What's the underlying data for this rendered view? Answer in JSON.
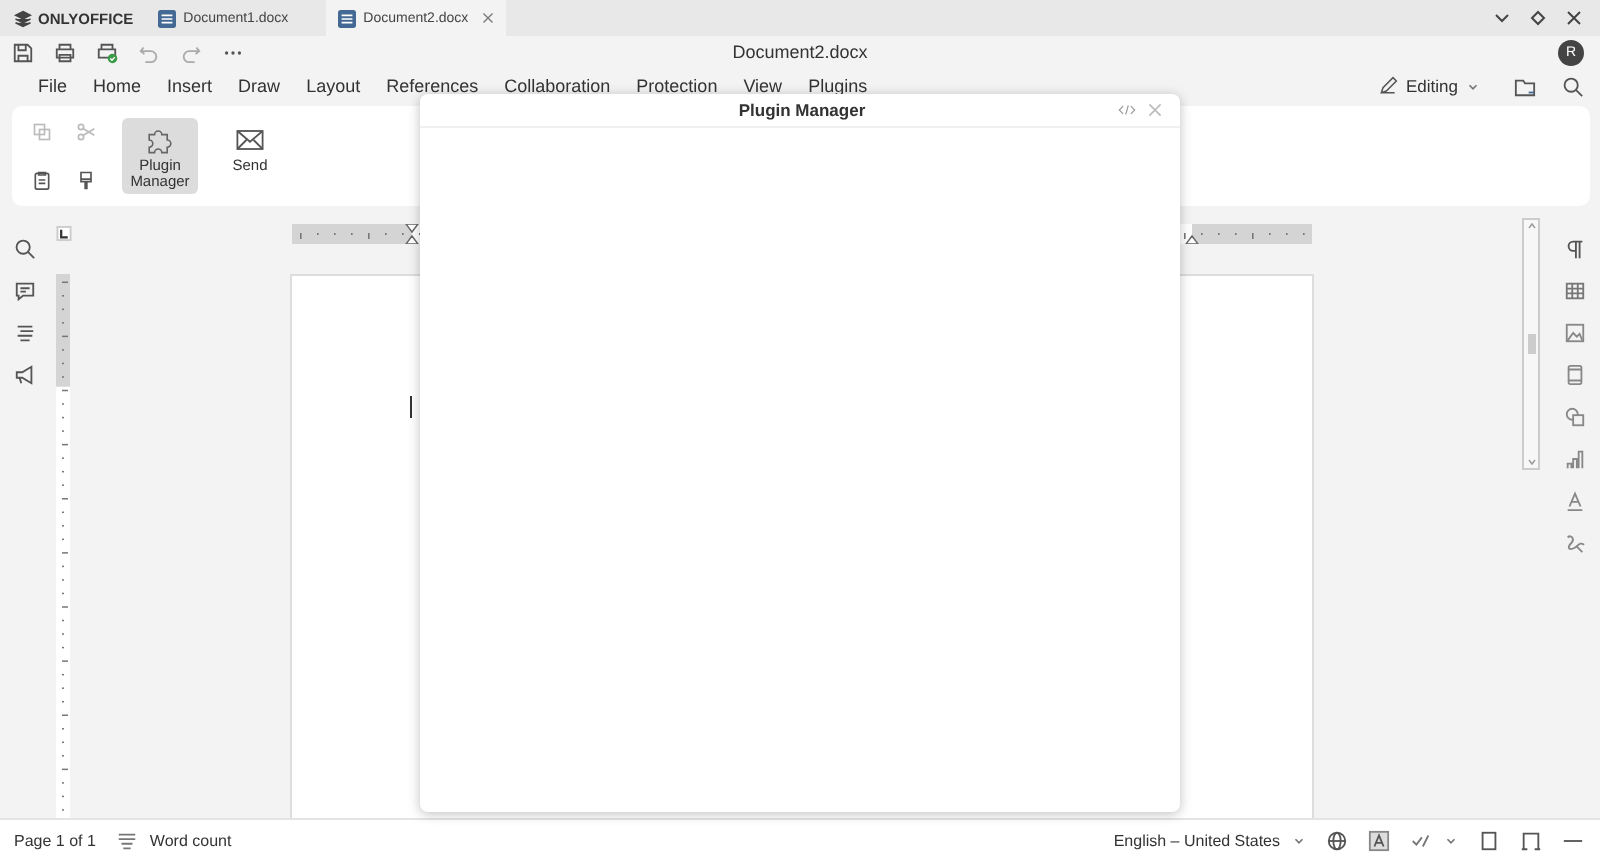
{
  "app": {
    "name": "ONLYOFFICE"
  },
  "tabs": [
    {
      "label": "Document1.docx",
      "selected": false
    },
    {
      "label": "Document2.docx",
      "selected": true
    }
  ],
  "document_title": "Document2.docx",
  "user_initial": "R",
  "menu": [
    {
      "label": "File"
    },
    {
      "label": "Home"
    },
    {
      "label": "Insert"
    },
    {
      "label": "Draw"
    },
    {
      "label": "Layout"
    },
    {
      "label": "References"
    },
    {
      "label": "Collaboration"
    },
    {
      "label": "Protection"
    },
    {
      "label": "View"
    },
    {
      "label": "Plugins"
    }
  ],
  "mode": {
    "label": "Editing"
  },
  "ribbon": {
    "buttons": [
      {
        "kind": "plugins",
        "label": "Plugin Manager",
        "selected": true
      },
      {
        "kind": "send",
        "label": "Send",
        "selected": false
      }
    ]
  },
  "dialog": {
    "title": "Plugin Manager"
  },
  "status_bar": {
    "page": "Page 1 of 1",
    "word_count": "Word count",
    "language": "English – United States"
  }
}
